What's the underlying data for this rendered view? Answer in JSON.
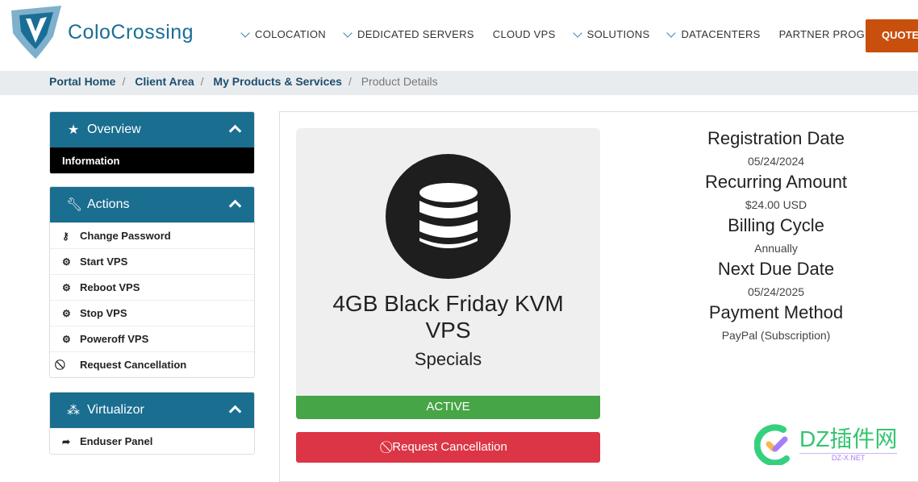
{
  "header": {
    "brand": "ColoCrossing",
    "nav": [
      {
        "label": "COLOCATION",
        "dropdown": true
      },
      {
        "label": "DEDICATED SERVERS",
        "dropdown": true
      },
      {
        "label": "CLOUD VPS",
        "dropdown": false
      },
      {
        "label": "SOLUTIONS",
        "dropdown": true
      },
      {
        "label": "DATACENTERS",
        "dropdown": true
      },
      {
        "label": "PARTNER PROGRAM",
        "dropdown": false
      }
    ],
    "quote": "QUOTE"
  },
  "breadcrumb": [
    "Portal Home",
    "Client Area",
    "My Products & Services",
    "Product Details"
  ],
  "sidebar": {
    "overview": {
      "title": "Overview",
      "items": [
        "Information"
      ]
    },
    "actions": {
      "title": "Actions",
      "items": [
        "Change Password",
        "Start VPS",
        "Reboot VPS",
        "Stop VPS",
        "Poweroff VPS",
        "Request Cancellation"
      ]
    },
    "virtualizor": {
      "title": "Virtualizor",
      "items": [
        "Enduser Panel"
      ]
    }
  },
  "product": {
    "name": "4GB Black Friday KVM VPS",
    "group": "Specials",
    "status": "ACTIVE",
    "cancel": "Request Cancellation",
    "status_color": "#46a546"
  },
  "details": [
    {
      "label": "Registration Date",
      "value": "05/24/2024"
    },
    {
      "label": "Recurring Amount",
      "value": "$24.00 USD"
    },
    {
      "label": "Billing Cycle",
      "value": "Annually"
    },
    {
      "label": "Next Due Date",
      "value": "05/24/2025"
    },
    {
      "label": "Payment Method",
      "value": "PayPal (Subscription)"
    }
  ],
  "watermark": {
    "text": "DZ插件网",
    "sub": "DZ-X.NET"
  }
}
